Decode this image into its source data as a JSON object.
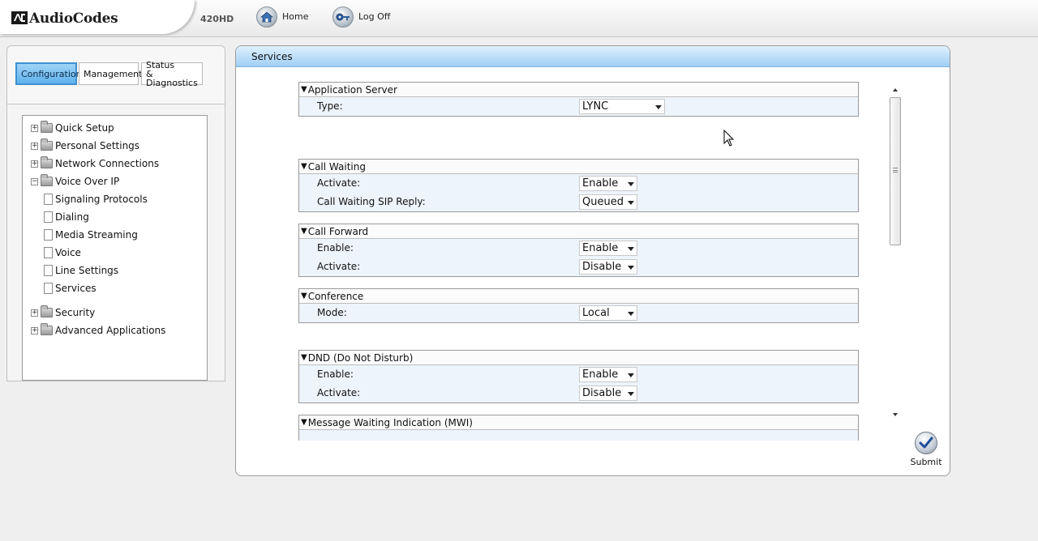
{
  "header": {
    "brand": "AudioCodes",
    "model": "420HD",
    "home_label": "Home",
    "logoff_label": "Log Off"
  },
  "tabs": [
    {
      "label": "Configuration",
      "active": true
    },
    {
      "label": "Management",
      "active": false
    },
    {
      "label_line1": "Status",
      "label_line2": "& Diagnostics",
      "active": false
    }
  ],
  "tree": {
    "items": [
      {
        "label": "Quick Setup",
        "type": "folder",
        "expander": "+"
      },
      {
        "label": "Personal Settings",
        "type": "folder",
        "expander": "+"
      },
      {
        "label": "Network Connections",
        "type": "folder",
        "expander": "+"
      },
      {
        "label": "Voice Over IP",
        "type": "folder",
        "expander": "−"
      },
      {
        "label": "Signaling Protocols",
        "type": "page"
      },
      {
        "label": "Dialing",
        "type": "page"
      },
      {
        "label": "Media Streaming",
        "type": "page"
      },
      {
        "label": "Voice",
        "type": "page"
      },
      {
        "label": "Line Settings",
        "type": "page"
      },
      {
        "label": "Services",
        "type": "page"
      },
      {
        "label": "Security",
        "type": "folder",
        "expander": "+"
      },
      {
        "label": "Advanced Applications",
        "type": "folder",
        "expander": "+"
      }
    ]
  },
  "main": {
    "title": "Services",
    "sections": [
      {
        "title": "Application Server",
        "fields": [
          {
            "label": "Type:",
            "value": "LYNC"
          }
        ]
      },
      {
        "title": "Call Waiting",
        "fields": [
          {
            "label": "Activate:",
            "value": "Enable"
          },
          {
            "label": "Call Waiting SIP Reply:",
            "value": "Queued"
          }
        ]
      },
      {
        "title": "Call Forward",
        "fields": [
          {
            "label": "Enable:",
            "value": "Enable"
          },
          {
            "label": "Activate:",
            "value": "Disable"
          }
        ]
      },
      {
        "title": "Conference",
        "fields": [
          {
            "label": "Mode:",
            "value": "Local"
          }
        ]
      },
      {
        "title": "DND (Do Not Disturb)",
        "fields": [
          {
            "label": "Enable:",
            "value": "Enable"
          },
          {
            "label": "Activate:",
            "value": "Disable"
          }
        ]
      },
      {
        "title": "Message Waiting Indication (MWI)",
        "fields": []
      }
    ],
    "submit_label": "Submit"
  },
  "icons": {
    "home": "home-icon",
    "logoff": "key-icon",
    "submit": "checkmark-icon"
  },
  "colors": {
    "title_bar": "#9fcff5",
    "active_tab": "#5fb2ec",
    "section_bg": "#eef4fb"
  }
}
